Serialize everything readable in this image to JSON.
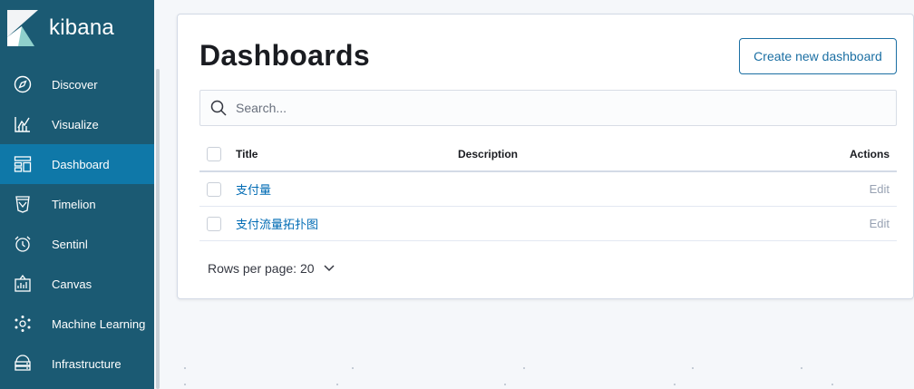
{
  "app": {
    "brand": "kibana"
  },
  "sidebar": {
    "items": [
      {
        "label": "Discover",
        "icon": "compass-icon"
      },
      {
        "label": "Visualize",
        "icon": "chart-icon"
      },
      {
        "label": "Dashboard",
        "icon": "dashboard-icon",
        "active": true
      },
      {
        "label": "Timelion",
        "icon": "timelion-icon"
      },
      {
        "label": "Sentinl",
        "icon": "alarm-clock-icon"
      },
      {
        "label": "Canvas",
        "icon": "canvas-icon"
      },
      {
        "label": "Machine Learning",
        "icon": "ml-icon"
      },
      {
        "label": "Infrastructure",
        "icon": "infrastructure-icon"
      }
    ]
  },
  "page": {
    "title": "Dashboards",
    "create_button": "Create new dashboard",
    "search_placeholder": "Search..."
  },
  "table": {
    "headers": {
      "title": "Title",
      "description": "Description",
      "actions": "Actions"
    },
    "rows": [
      {
        "title": "支付量",
        "description": "",
        "action": "Edit"
      },
      {
        "title": "支付流量拓扑图",
        "description": "",
        "action": "Edit"
      }
    ]
  },
  "pagination": {
    "rows_per_page": "Rows per page: 20"
  },
  "colors": {
    "sidebar": "#1b5a73",
    "active": "#0f78a8",
    "link": "#006bb4",
    "accent": "#1b6fa3"
  }
}
